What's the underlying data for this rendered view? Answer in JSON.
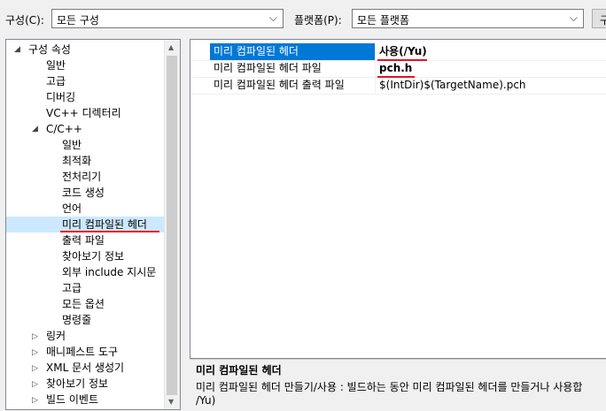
{
  "toolbar": {
    "config_label": "구성(C):",
    "config_value": "모든 구성",
    "platform_label": "플랫폼(P):",
    "platform_value": "모든 플랫폼",
    "cut_button_label": "구"
  },
  "tree": {
    "root": "구성 속성",
    "items": [
      "일반",
      "고급",
      "디버깅",
      "VC++ 디렉터리"
    ],
    "cpp": {
      "label": "C/C++",
      "children": [
        "일반",
        "최적화",
        "전처리기",
        "코드 생성",
        "언어",
        "미리 컴파일된 헤더",
        "출력 파일",
        "찾아보기 정보",
        "외부 include 지시문",
        "고급",
        "모든 옵션",
        "명령줄"
      ],
      "selected": "미리 컴파일된 헤더"
    },
    "collapsed": [
      "링커",
      "매니페스트 도구",
      "XML 문서 생성기",
      "찾아보기 정보",
      "빌드 이벤트"
    ]
  },
  "grid": {
    "rows": [
      {
        "name": "미리 컴파일된 헤더",
        "value": "사용(/Yu)"
      },
      {
        "name": "미리 컴파일된 헤더 파일",
        "value": "pch.h"
      },
      {
        "name": "미리 컴파일된 헤더 출력 파일",
        "value": "$(IntDir)$(TargetName).pch"
      }
    ]
  },
  "description": {
    "title": "미리 컴파일된 헤더",
    "body": "미리 컴파일된 헤더 만들기/사용 : 빌드하는 동안 미리 컴파일된 헤더를 만들거나 사용합",
    "body2": "/Yu)"
  },
  "colors": {
    "selection": "#0078d7",
    "tree_selection": "#cce8ff",
    "underline": "#e81123"
  }
}
